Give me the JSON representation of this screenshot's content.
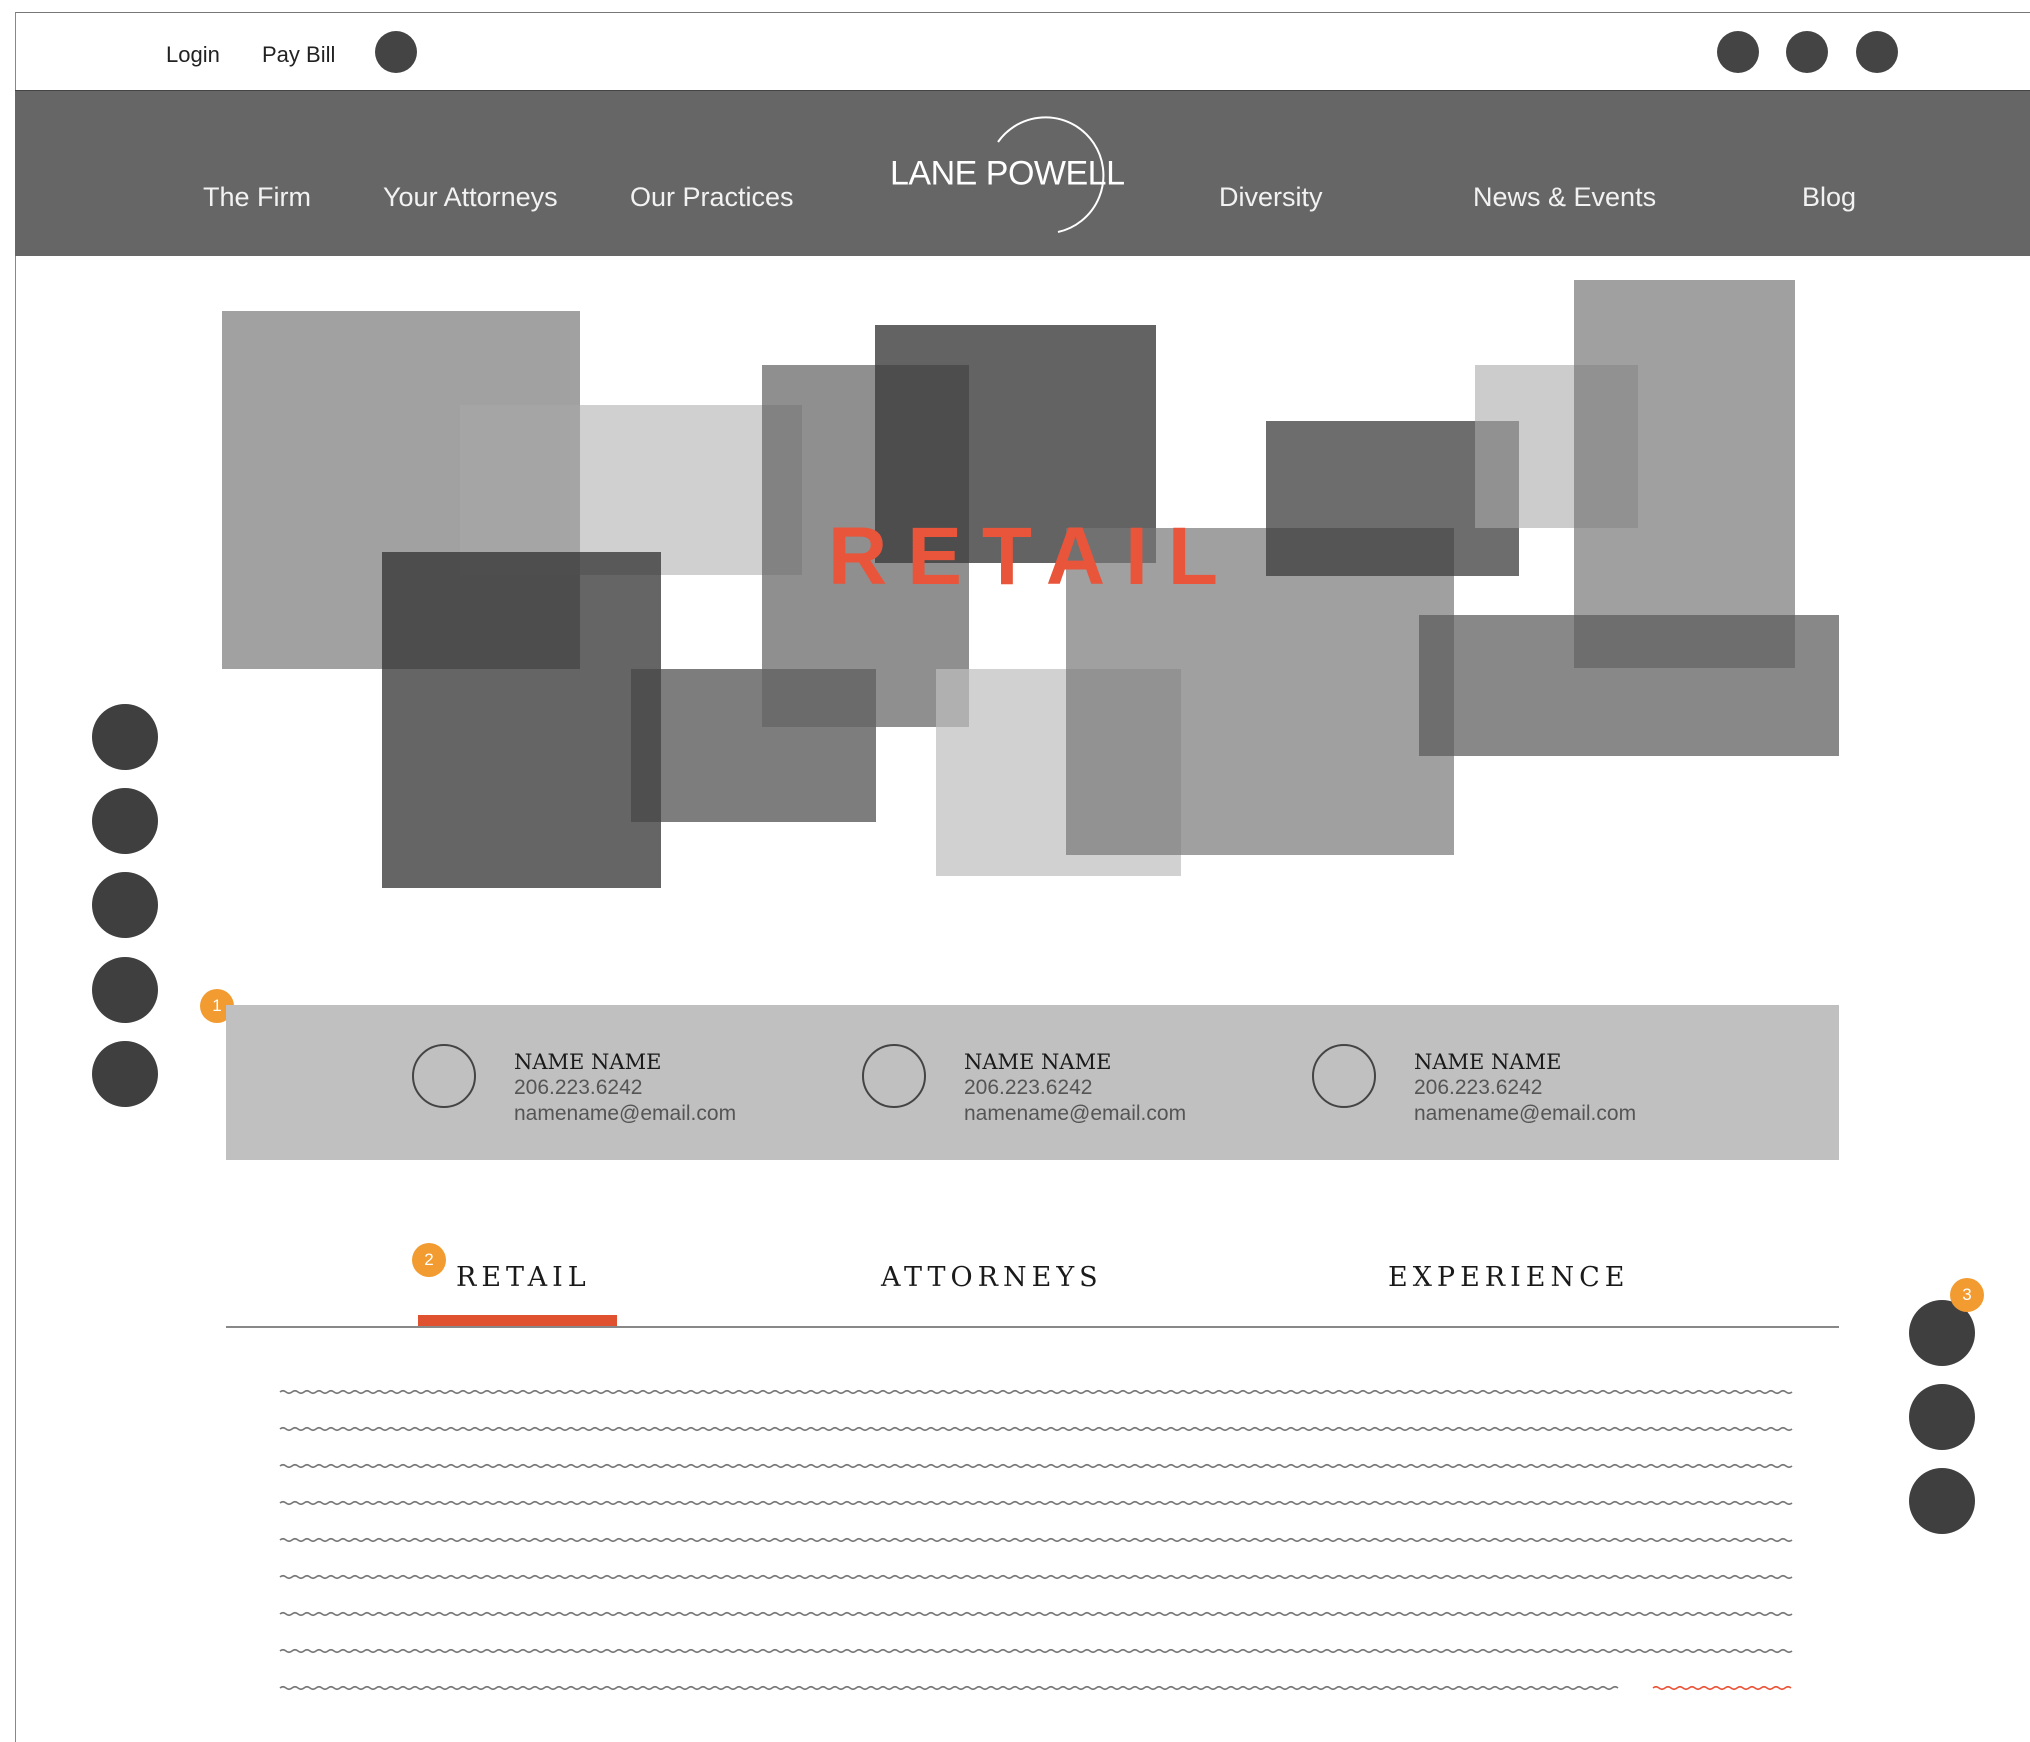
{
  "utility": {
    "login_label": "Login",
    "pay_bill_label": "Pay Bill"
  },
  "nav": {
    "items": [
      "The Firm",
      "Your Attorneys",
      "Our Practices",
      "Diversity",
      "News & Events",
      "Blog"
    ],
    "logo_text": "LANE POWELL"
  },
  "hero": {
    "title": "RETAIL"
  },
  "annotations": [
    "1",
    "2",
    "3"
  ],
  "contacts": [
    {
      "name": "NAME NAME",
      "phone": "206.223.6242",
      "email": "namename@email.com"
    },
    {
      "name": "NAME NAME",
      "phone": "206.223.6242",
      "email": "namename@email.com"
    },
    {
      "name": "NAME NAME",
      "phone": "206.223.6242",
      "email": "namename@email.com"
    }
  ],
  "tabs": {
    "items": [
      "RETAIL",
      "ATTORNEYS",
      "EXPERIENCE"
    ],
    "active": "RETAIL"
  },
  "colors": {
    "accent": "#e8553a",
    "annotation": "#f29b30",
    "nav_bg": "#666666",
    "contact_bg": "#c0c0c0"
  },
  "icons": {
    "utility_search": "circle-icon",
    "social": [
      "circle-icon",
      "circle-icon",
      "circle-icon"
    ],
    "share_rail": [
      "circle-icon",
      "circle-icon",
      "circle-icon",
      "circle-icon",
      "circle-icon"
    ],
    "right_rail": [
      "circle-icon",
      "circle-icon",
      "circle-icon"
    ]
  }
}
